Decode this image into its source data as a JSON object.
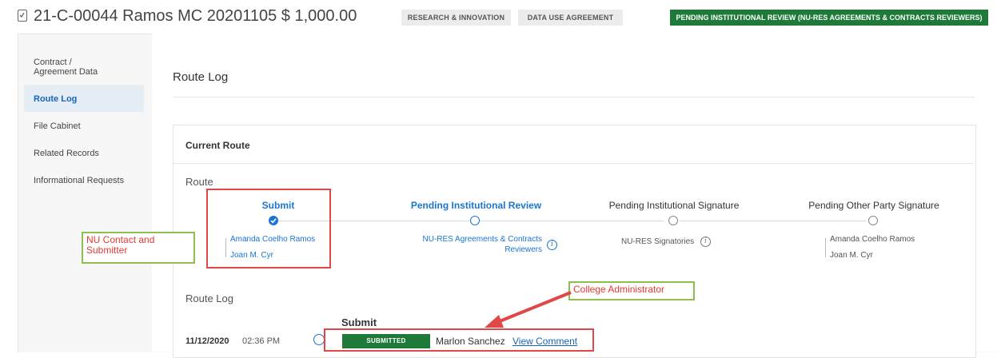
{
  "header": {
    "record_title": "21-C-00044 Ramos MC 20201105 $ 1,000.00",
    "tags": [
      "RESEARCH & INNOVATION",
      "DATA USE AGREEMENT"
    ],
    "status": "PENDING INSTITUTIONAL REVIEW (NU-RES AGREEMENTS & CONTRACTS REVIEWERS)"
  },
  "sidebar": {
    "items": [
      {
        "label": "Contract / Agreement Data"
      },
      {
        "label": "Route Log",
        "active": true
      },
      {
        "label": "File Cabinet"
      },
      {
        "label": "Related Records"
      },
      {
        "label": "Informational Requests"
      }
    ]
  },
  "main": {
    "page_title": "Route Log",
    "card_title": "Current Route",
    "route_label": "Route",
    "route_log_label": "Route Log",
    "stages": [
      {
        "title": "Submit",
        "people": [
          "Amanda Coelho Ramos",
          "Joan M. Cyr"
        ],
        "state": "completed"
      },
      {
        "title": "Pending Institutional Review",
        "people": [
          "NU-RES Agreements & Contracts",
          "Reviewers"
        ],
        "state": "current"
      },
      {
        "title": "Pending Institutional Signature",
        "people": [
          "NU-RES Signatories"
        ],
        "state": "upcoming"
      },
      {
        "title": "Pending Other Party Signature",
        "people": [
          "Amanda Coelho Ramos",
          "Joan M. Cyr"
        ],
        "state": "upcoming"
      }
    ],
    "log_entries": [
      {
        "date": "11/12/2020",
        "time": "02:36 PM",
        "action": "Submit",
        "badge": "SUBMITTED",
        "user": "Marlon Sanchez",
        "link": "View Comment"
      }
    ]
  },
  "annotations": {
    "note_submitter": "NU Contact and Submitter",
    "note_admin": "College Administrator"
  },
  "colors": {
    "brand_blue": "#1976d2",
    "status_green": "#1f7a3a",
    "annotation_red": "#e04848",
    "annotation_green": "#8cbf4b"
  }
}
